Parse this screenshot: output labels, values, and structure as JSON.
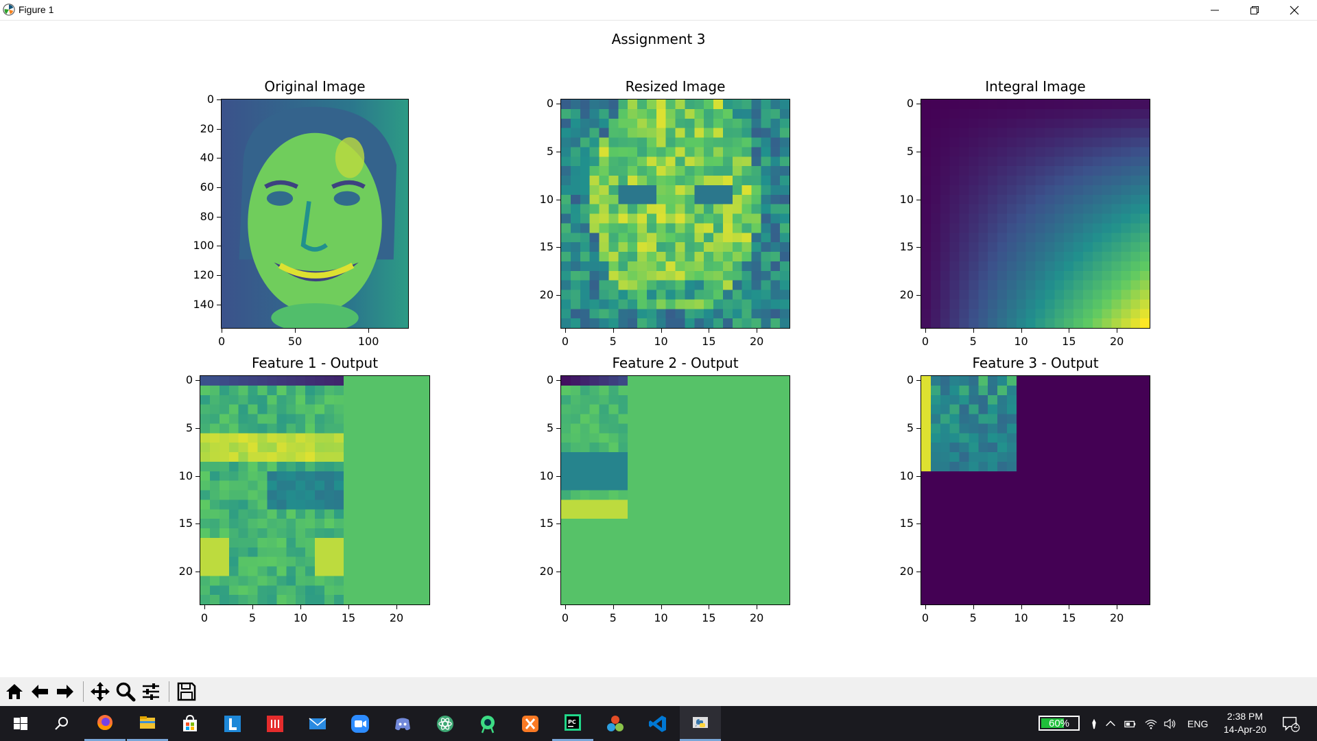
{
  "window": {
    "title": "Figure 1",
    "icon": "matplotlib-icon",
    "controls": [
      "minimize-icon",
      "maximize-icon",
      "close-icon"
    ]
  },
  "figure": {
    "suptitle": "Assignment 3",
    "subplots": [
      {
        "title": "Original Image",
        "yticks": [
          "0",
          "20",
          "40",
          "60",
          "80",
          "100",
          "120",
          "140"
        ],
        "xticks": [
          "0",
          "50",
          "100"
        ]
      },
      {
        "title": "Resized Image",
        "yticks": [
          "0",
          "5",
          "10",
          "15",
          "20"
        ],
        "xticks": [
          "0",
          "5",
          "10",
          "15",
          "20"
        ]
      },
      {
        "title": "Integral Image",
        "yticks": [
          "0",
          "5",
          "10",
          "15",
          "20"
        ],
        "xticks": [
          "0",
          "5",
          "10",
          "15",
          "20"
        ]
      },
      {
        "title": "Feature 1 - Output",
        "yticks": [
          "0",
          "5",
          "10",
          "15",
          "20"
        ],
        "xticks": [
          "0",
          "5",
          "10",
          "15",
          "20"
        ]
      },
      {
        "title": "Feature 2 - Output",
        "yticks": [
          "0",
          "5",
          "10",
          "15",
          "20"
        ],
        "xticks": [
          "0",
          "5",
          "10",
          "15",
          "20"
        ]
      },
      {
        "title": "Feature 3 - Output",
        "yticks": [
          "0",
          "5",
          "10",
          "15",
          "20"
        ],
        "xticks": [
          "0",
          "5",
          "10",
          "15",
          "20"
        ]
      }
    ],
    "colormap": [
      "#440154",
      "#3b528b",
      "#21908d",
      "#5dc963",
      "#fde725"
    ]
  },
  "toolbar": {
    "buttons": [
      "home-icon",
      "back-icon",
      "forward-icon",
      "pan-icon",
      "zoom-icon",
      "configure-subplots-icon",
      "save-icon"
    ]
  },
  "taskbar": {
    "apps": [
      "start-icon",
      "search-icon",
      "firefox-icon",
      "file-explorer-icon",
      "store-icon",
      "l-app-icon",
      "red-app-icon",
      "mail-icon",
      "zoom-app-icon",
      "discord-icon",
      "atom-icon",
      "android-studio-icon",
      "xampp-icon",
      "pycharm-icon",
      "davinci-icon",
      "vscode-icon",
      "python-icon"
    ],
    "battery": "60%",
    "language": "ENG",
    "time": "2:38 PM",
    "date": "14-Apr-20",
    "notifications": "2"
  }
}
